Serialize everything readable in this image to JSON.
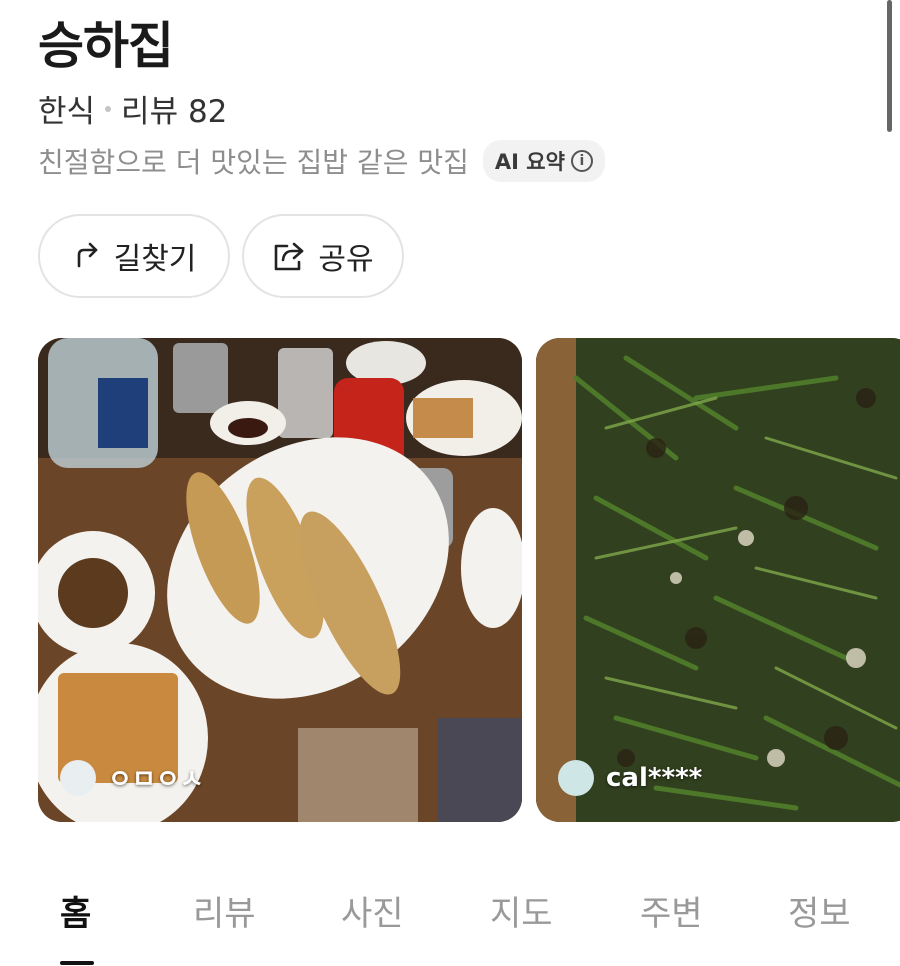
{
  "place": {
    "name": "승하집",
    "category": "한식",
    "review_label": "리뷰",
    "review_count": "82",
    "summary": "친절함으로 더 맛있는 집밥 같은 맛집",
    "ai_chip_label": "AI 요약"
  },
  "actions": {
    "directions_label": "길찾기",
    "share_label": "공유"
  },
  "photos": [
    {
      "credit": "ㅇㅁㅇㅅ",
      "description_icon": "grilled-fish-meal-photo"
    },
    {
      "credit": "cal****",
      "description_icon": "chive-pancake-photo"
    }
  ],
  "tabs": [
    "홈",
    "리뷰",
    "사진",
    "지도",
    "주변",
    "정보"
  ],
  "active_tab_index": 0,
  "colors": {
    "text_primary": "#1a1a1a",
    "text_secondary": "#8e8e8e",
    "chip_bg": "#f2f2f2",
    "border": "#e3e3e3"
  }
}
